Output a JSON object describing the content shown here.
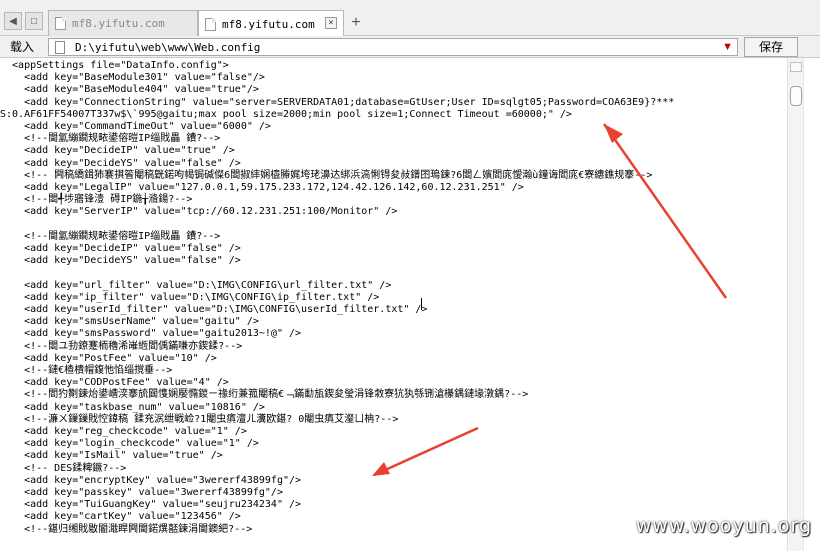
{
  "tabs": [
    {
      "label": "mf8.yifutu.com",
      "active": false
    },
    {
      "label": "mf8.yifutu.com",
      "active": true
    }
  ],
  "tab_close_symbol": "×",
  "new_tab_symbol": "+",
  "address_bar": {
    "load_label": "载入",
    "path": "D:\\yifutu\\web\\www\\Web.config",
    "save_label": "保存",
    "dropdown_symbol": "▼"
  },
  "code_lines": [
    "  <appSettings file=\"DataInfo.config\">",
    "    <add key=\"BaseModule301\" value=\"false\"/>",
    "    <add key=\"BaseModule404\" value=\"true\"/>",
    "    <add key=\"ConnectionString\" value=\"server=SERVERDATA01;database=GtUser;User ID=sqlgt05;Password=COA63E9}?***",
    "S:0.AF61FF54007T337w$\\`995@gaitu;max pool size=2000;min pool size=1;Connect Timeout =60000;\" />",
    "    <add key=\"CommandTimeOut\" value=\"6000\" />",
    "    <!--閫氳繃鐗规畩鍙傛暟IP缁戝畾 鐨?-->",
    "    <add key=\"DecideIP\" value=\"true\" />",
    "    <add key=\"DecideYS\" value=\"false\" />",
    "    <!-- 闁稿繑鍓犻褰掑箵閹稿皝鍩呴幆锔碱儏6閸掓繂娴橀幐娓垮珯濞达綁浜滈悧锝夋敊鐠囨瑦鍊?6閸ㄥ嬪閻庣懓瀚ù鐘诲閻庣€寮繐鐎规搴-->",
    "    <add key=\"LegalIP\" value=\"127.0.0.1,59.175.233.172,124.42.126.142,60.12.231.251\" />",
    "    <!--閸╃埗寤锋潱 碍IP鍦╁潃鍚?-->",
    "    <add key=\"ServerIP\" value=\"tcp://60.12.231.251:100/Monitor\" />",
    "",
    "    <!--閫氳繃鐗规畩鍙傛暟IP缁戝畾 鐨?-->",
    "    <add key=\"DecideIP\" value=\"false\" />",
    "    <add key=\"DecideYS\" value=\"false\" />",
    "",
    "    <add key=\"url_filter\" value=\"D:\\IMG\\CONFIG\\url_filter.txt\" />",
    "    <add key=\"ip_filter\" value=\"D:\\IMG\\CONFIG\\ip_filter.txt\" />",
    "    <add key=\"userId_filter\" value=\"D:\\IMG\\CONFIG\\userId_filter.txt\" />",
    "    <add key=\"smsUserName\" value=\"gaitu\" />",
    "    <add key=\"smsPassword\" value=\"gaitu2013~!@\" />",
    "    <!--閸ユ劧鐐蹇栭穭浠嶉緪閻偊鏋嗛亦鍥鍒?-->",
    "    <add key=\"PostFee\" value=\"10\" />",
    "    <!--鏈€楂樻帽鍑忚惂缁撹垂-->",
    "    <add key=\"CODPostFee\" value=\"4\" />",
    "    <!--閻犳劗鍊炲鍙嶆湙搴旈閮愯娴嬮憜鍐ㄧ禒绗兼箛閹稿€﹁鏋勫瓬鍥夋瑩涓锋敹寮犺犱綔铏滄櫀鍝鏈堟潡鍝?-->",
    "    <add key=\"taskbase_num\" value=\"10816\" />",
    "    <!--濂ㄨ鏁鏁戝悾鍏稿 鍒充泦绁戦崄?1閹虫瘨澶ㄦ瀵欧鍖? 0閹虫瘨艾瀣ㄩ柟?-->",
    "    <add key=\"reg_checkcode\" value=\"1\" />",
    "    <add key=\"login_checkcode\" value=\"1\" />",
    "    <add key=\"IsMail\" value=\"true\" />",
    "    <!-- DES鍒粺鐝?-->",
    "    <add key=\"encryptKey\" value=\"3wererf43899fg\"/>",
    "    <add key=\"passkey\" value=\"3wererf43899fg\"/>",
    "    <add key=\"TuiGuangKey\" value=\"seujru234234\" />",
    "    <add key=\"cartKey\" value=\"123456\" />",
    "    <!--鍖归缃戝敭閽濈睅闁閫鍩熼嚭鍊涓閫鐭紦?-->"
  ],
  "annotation_color": "#e8412f",
  "watermark": "www.wooyun.org"
}
